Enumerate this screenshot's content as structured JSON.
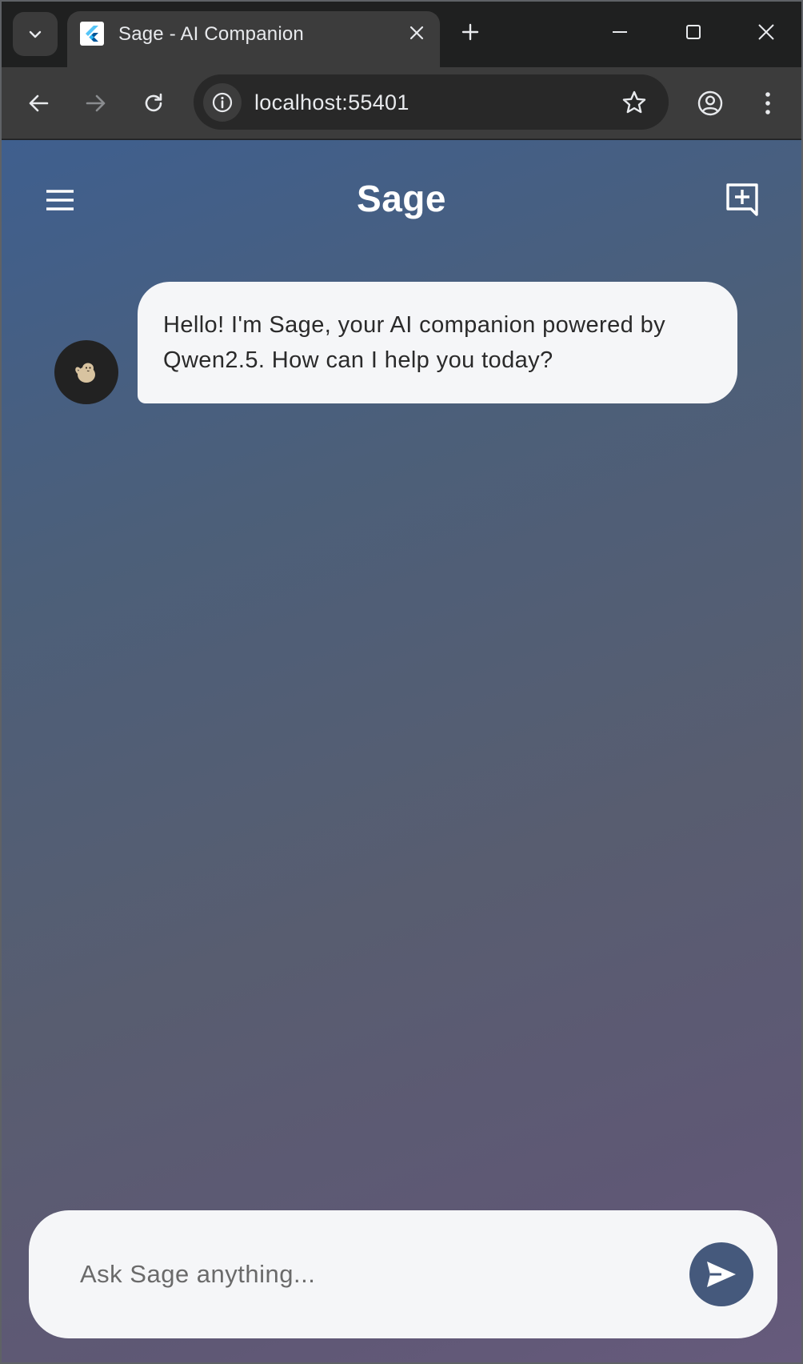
{
  "browser": {
    "tab_title": "Sage - AI Companion",
    "url": "localhost:55401"
  },
  "app": {
    "title": "Sage",
    "messages": [
      {
        "sender": "assistant",
        "text": "Hello! I'm Sage, your AI companion powered by Qwen2.5. How can I help you today?"
      }
    ],
    "composer": {
      "placeholder": "Ask Sage anything..."
    }
  },
  "colors": {
    "gradient_start": "#3f5f8e",
    "gradient_end": "#665a7c",
    "send_button": "#45597c",
    "bubble_bg": "#f5f6f8"
  }
}
